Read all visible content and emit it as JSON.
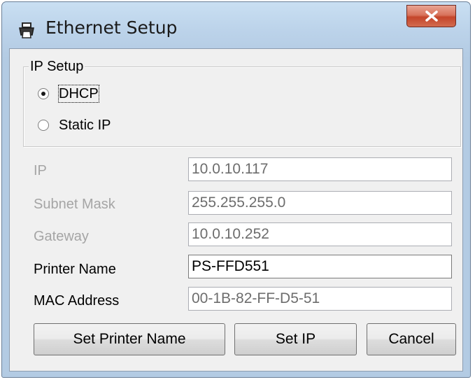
{
  "window": {
    "title": "Ethernet Setup",
    "title_icon": "printer-icon",
    "close_icon": "close-icon"
  },
  "ip_setup": {
    "legend": "IP Setup",
    "options": [
      {
        "label": "DHCP",
        "selected": true
      },
      {
        "label": "Static IP",
        "selected": false
      }
    ]
  },
  "fields": {
    "ip": {
      "label": "IP",
      "value": "10.0.10.117"
    },
    "subnet_mask": {
      "label": "Subnet Mask",
      "value": "255.255.255.0"
    },
    "gateway": {
      "label": "Gateway",
      "value": "10.0.10.252"
    },
    "printer_name": {
      "label": "Printer Name",
      "value": "PS-FFD551"
    },
    "mac_address": {
      "label": "MAC Address",
      "value": "00-1B-82-FF-D5-51"
    }
  },
  "buttons": {
    "set_printer_name": "Set Printer Name",
    "set_ip": "Set IP",
    "cancel": "Cancel"
  }
}
